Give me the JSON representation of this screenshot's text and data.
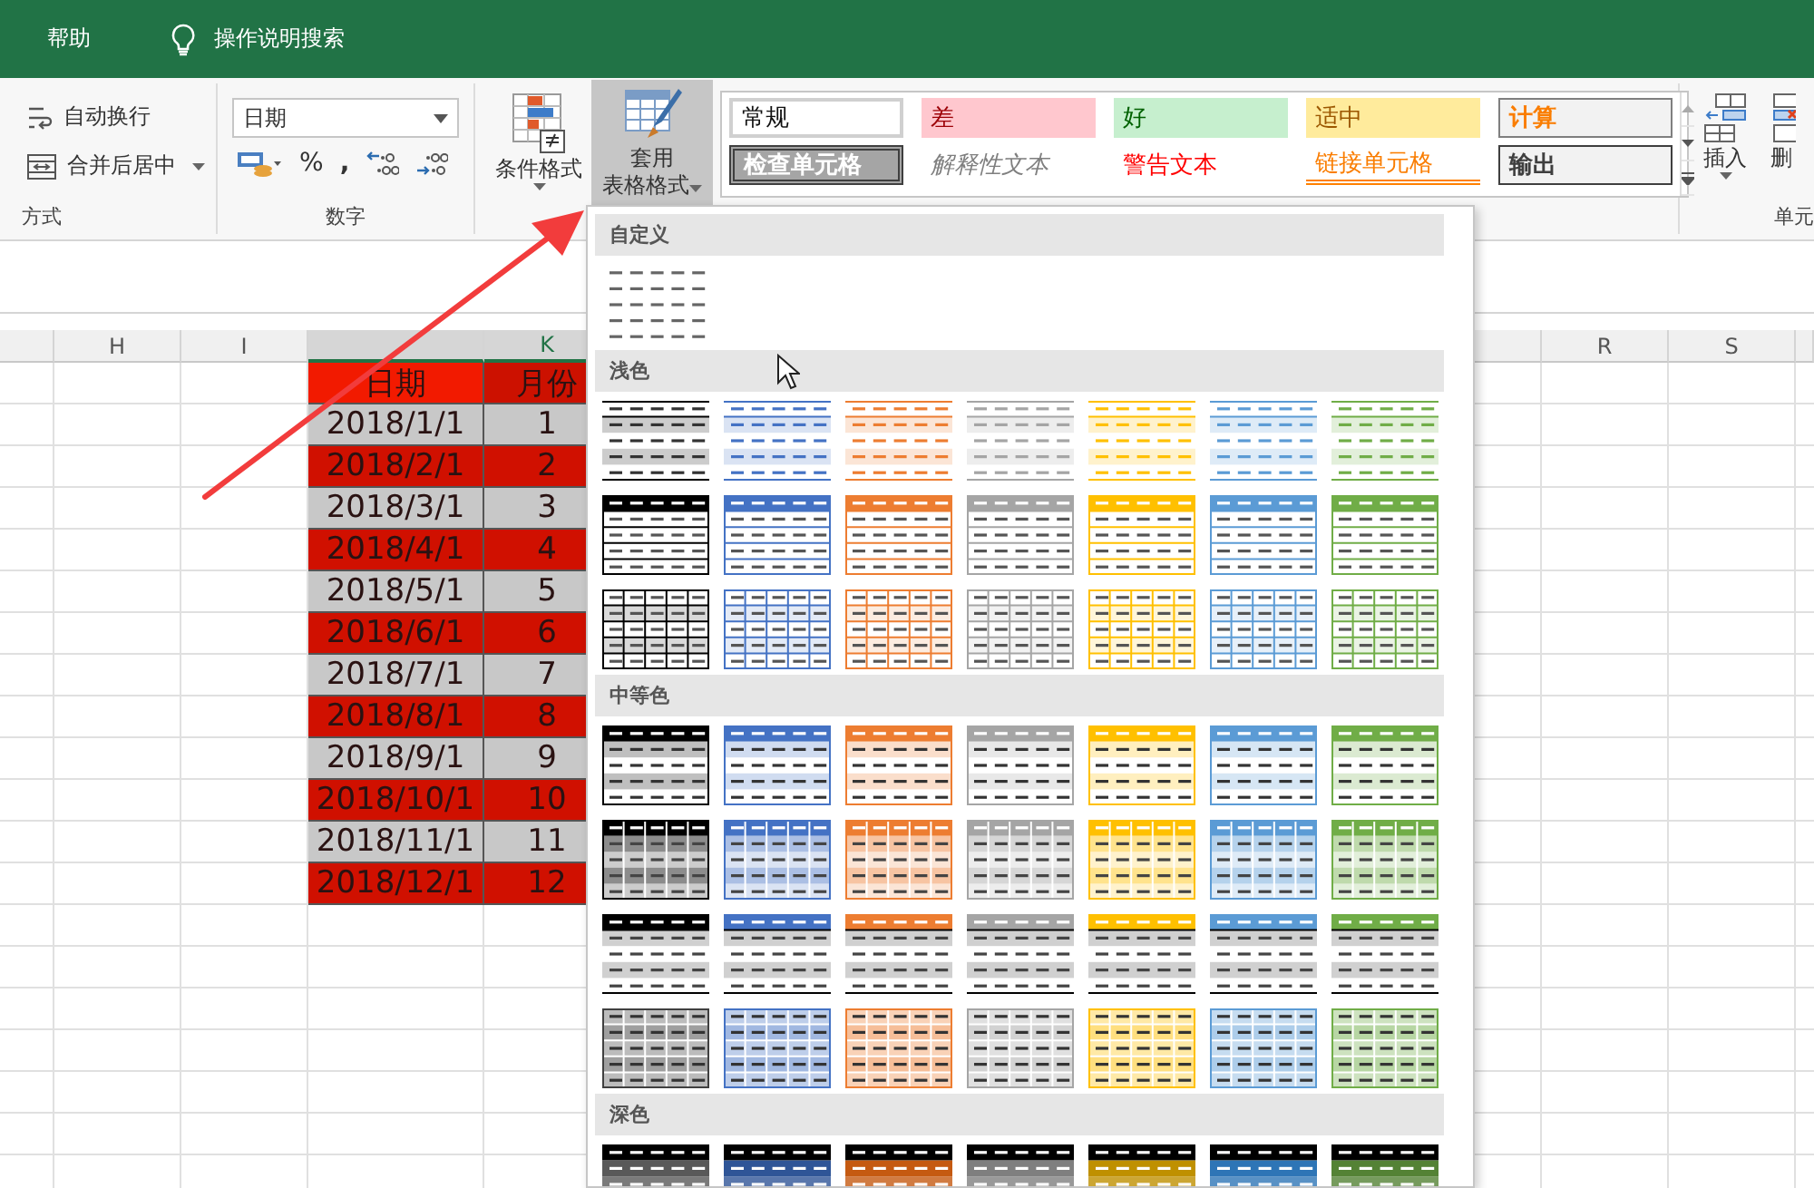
{
  "title_bar": {
    "tabs": [
      {
        "label": "帮助",
        "selected": false
      }
    ],
    "search": {
      "label": "操作说明搜索"
    }
  },
  "ribbon": {
    "alignment": {
      "wrap_text": "自动换行",
      "merge_center": "合并后居中",
      "group_label": "方式"
    },
    "number": {
      "format": "日期",
      "percent": "%",
      "comma": ",",
      "group_label": "数字"
    },
    "styles": {
      "conditional_formatting": "条件格式",
      "format_as_table": {
        "lines": [
          "套用",
          "表格格式"
        ],
        "expanded": true
      },
      "cell_styles": [
        {
          "label": "常规",
          "kind": "normal"
        },
        {
          "label": "差",
          "kind": "bad"
        },
        {
          "label": "好",
          "kind": "good"
        },
        {
          "label": "适中",
          "kind": "neutral"
        },
        {
          "label": "计算",
          "kind": "calculation"
        },
        {
          "label": "检查单元格",
          "kind": "check"
        },
        {
          "label": "解释性文本",
          "kind": "explanatory"
        },
        {
          "label": "警告文本",
          "kind": "warning"
        },
        {
          "label": "链接单元格",
          "kind": "linked"
        },
        {
          "label": "输出",
          "kind": "output"
        }
      ]
    },
    "cells": {
      "insert": "插入",
      "delete": "删",
      "group_label": "单元"
    }
  },
  "sheet": {
    "columns": [
      {
        "label": "H",
        "selected": false
      },
      {
        "label": "I",
        "selected": false
      },
      {
        "label": "K",
        "selected": true
      },
      {
        "label": "R",
        "selected": false
      },
      {
        "label": "S",
        "selected": false
      }
    ],
    "table": {
      "header": [
        {
          "text": "日期",
          "color": "#f21a00"
        },
        {
          "text": "月份",
          "color": "#cc1100"
        }
      ],
      "rows": [
        {
          "cells": [
            "2018/1/1",
            "1"
          ],
          "color": "#c8c8c8"
        },
        {
          "cells": [
            "2018/2/1",
            "2"
          ],
          "color": "#d01000"
        },
        {
          "cells": [
            "2018/3/1",
            "3"
          ],
          "color": "#c8c8c8"
        },
        {
          "cells": [
            "2018/4/1",
            "4"
          ],
          "color": "#d01000"
        },
        {
          "cells": [
            "2018/5/1",
            "5"
          ],
          "color": "#c8c8c8"
        },
        {
          "cells": [
            "2018/6/1",
            "6"
          ],
          "color": "#d01000"
        },
        {
          "cells": [
            "2018/7/1",
            "7"
          ],
          "color": "#c8c8c8"
        },
        {
          "cells": [
            "2018/8/1",
            "8"
          ],
          "color": "#d01000"
        },
        {
          "cells": [
            "2018/9/1",
            "9"
          ],
          "color": "#c8c8c8"
        },
        {
          "cells": [
            "2018/10/1",
            "10"
          ],
          "color": "#d01000"
        },
        {
          "cells": [
            "2018/11/1",
            "11"
          ],
          "color": "#c8c8c8"
        },
        {
          "cells": [
            "2018/12/1",
            "12"
          ],
          "color": "#d01000"
        }
      ]
    }
  },
  "table_style_menu": {
    "sections": [
      {
        "title": "自定义",
        "rows": [
          {
            "kind": "plain",
            "styles": [
              {
                "color": "#666666"
              }
            ]
          }
        ]
      },
      {
        "title": "浅色",
        "rows": [
          {
            "kind": "lines",
            "styles": [
              {
                "color": "#000000"
              },
              {
                "color": "#4472c4"
              },
              {
                "color": "#ed7d31"
              },
              {
                "color": "#a5a5a5"
              },
              {
                "color": "#ffc000"
              },
              {
                "color": "#5b9bd5"
              },
              {
                "color": "#70ad47"
              }
            ]
          },
          {
            "kind": "header",
            "styles": [
              {
                "color": "#000000"
              },
              {
                "color": "#4472c4"
              },
              {
                "color": "#ed7d31"
              },
              {
                "color": "#a5a5a5"
              },
              {
                "color": "#ffc000"
              },
              {
                "color": "#5b9bd5"
              },
              {
                "color": "#70ad47"
              }
            ]
          },
          {
            "kind": "grid",
            "styles": [
              {
                "color": "#000000"
              },
              {
                "color": "#4472c4"
              },
              {
                "color": "#ed7d31"
              },
              {
                "color": "#a5a5a5"
              },
              {
                "color": "#ffc000"
              },
              {
                "color": "#5b9bd5"
              },
              {
                "color": "#70ad47"
              }
            ]
          }
        ]
      },
      {
        "title": "中等色",
        "rows": [
          {
            "kind": "header-banded",
            "styles": [
              {
                "color": "#000000"
              },
              {
                "color": "#4472c4"
              },
              {
                "color": "#ed7d31"
              },
              {
                "color": "#a5a5a5"
              },
              {
                "color": "#ffc000"
              },
              {
                "color": "#5b9bd5"
              },
              {
                "color": "#70ad47"
              }
            ]
          },
          {
            "kind": "grid-banded",
            "styles": [
              {
                "color": "#000000"
              },
              {
                "color": "#4472c4"
              },
              {
                "color": "#ed7d31"
              },
              {
                "color": "#a5a5a5"
              },
              {
                "color": "#ffc000"
              },
              {
                "color": "#5b9bd5"
              },
              {
                "color": "#70ad47"
              }
            ]
          },
          {
            "kind": "topline",
            "styles": [
              {
                "color": "#000000"
              },
              {
                "color": "#4472c4"
              },
              {
                "color": "#ed7d31"
              },
              {
                "color": "#a5a5a5"
              },
              {
                "color": "#ffc000"
              },
              {
                "color": "#5b9bd5"
              },
              {
                "color": "#70ad47"
              }
            ]
          },
          {
            "kind": "grid-tinted",
            "styles": [
              {
                "color": "#404040"
              },
              {
                "color": "#4472c4"
              },
              {
                "color": "#ed7d31"
              },
              {
                "color": "#a5a5a5"
              },
              {
                "color": "#ffc000"
              },
              {
                "color": "#5b9bd5"
              },
              {
                "color": "#70ad47"
              }
            ]
          }
        ]
      },
      {
        "title": "深色",
        "rows": [
          {
            "kind": "dark",
            "styles": [
              {
                "color": "#595959"
              },
              {
                "color": "#2f5597"
              },
              {
                "color": "#c55a11"
              },
              {
                "color": "#7f7f7f"
              },
              {
                "color": "#bf9000"
              },
              {
                "color": "#2e75b6"
              },
              {
                "color": "#548235"
              }
            ]
          }
        ]
      }
    ]
  }
}
